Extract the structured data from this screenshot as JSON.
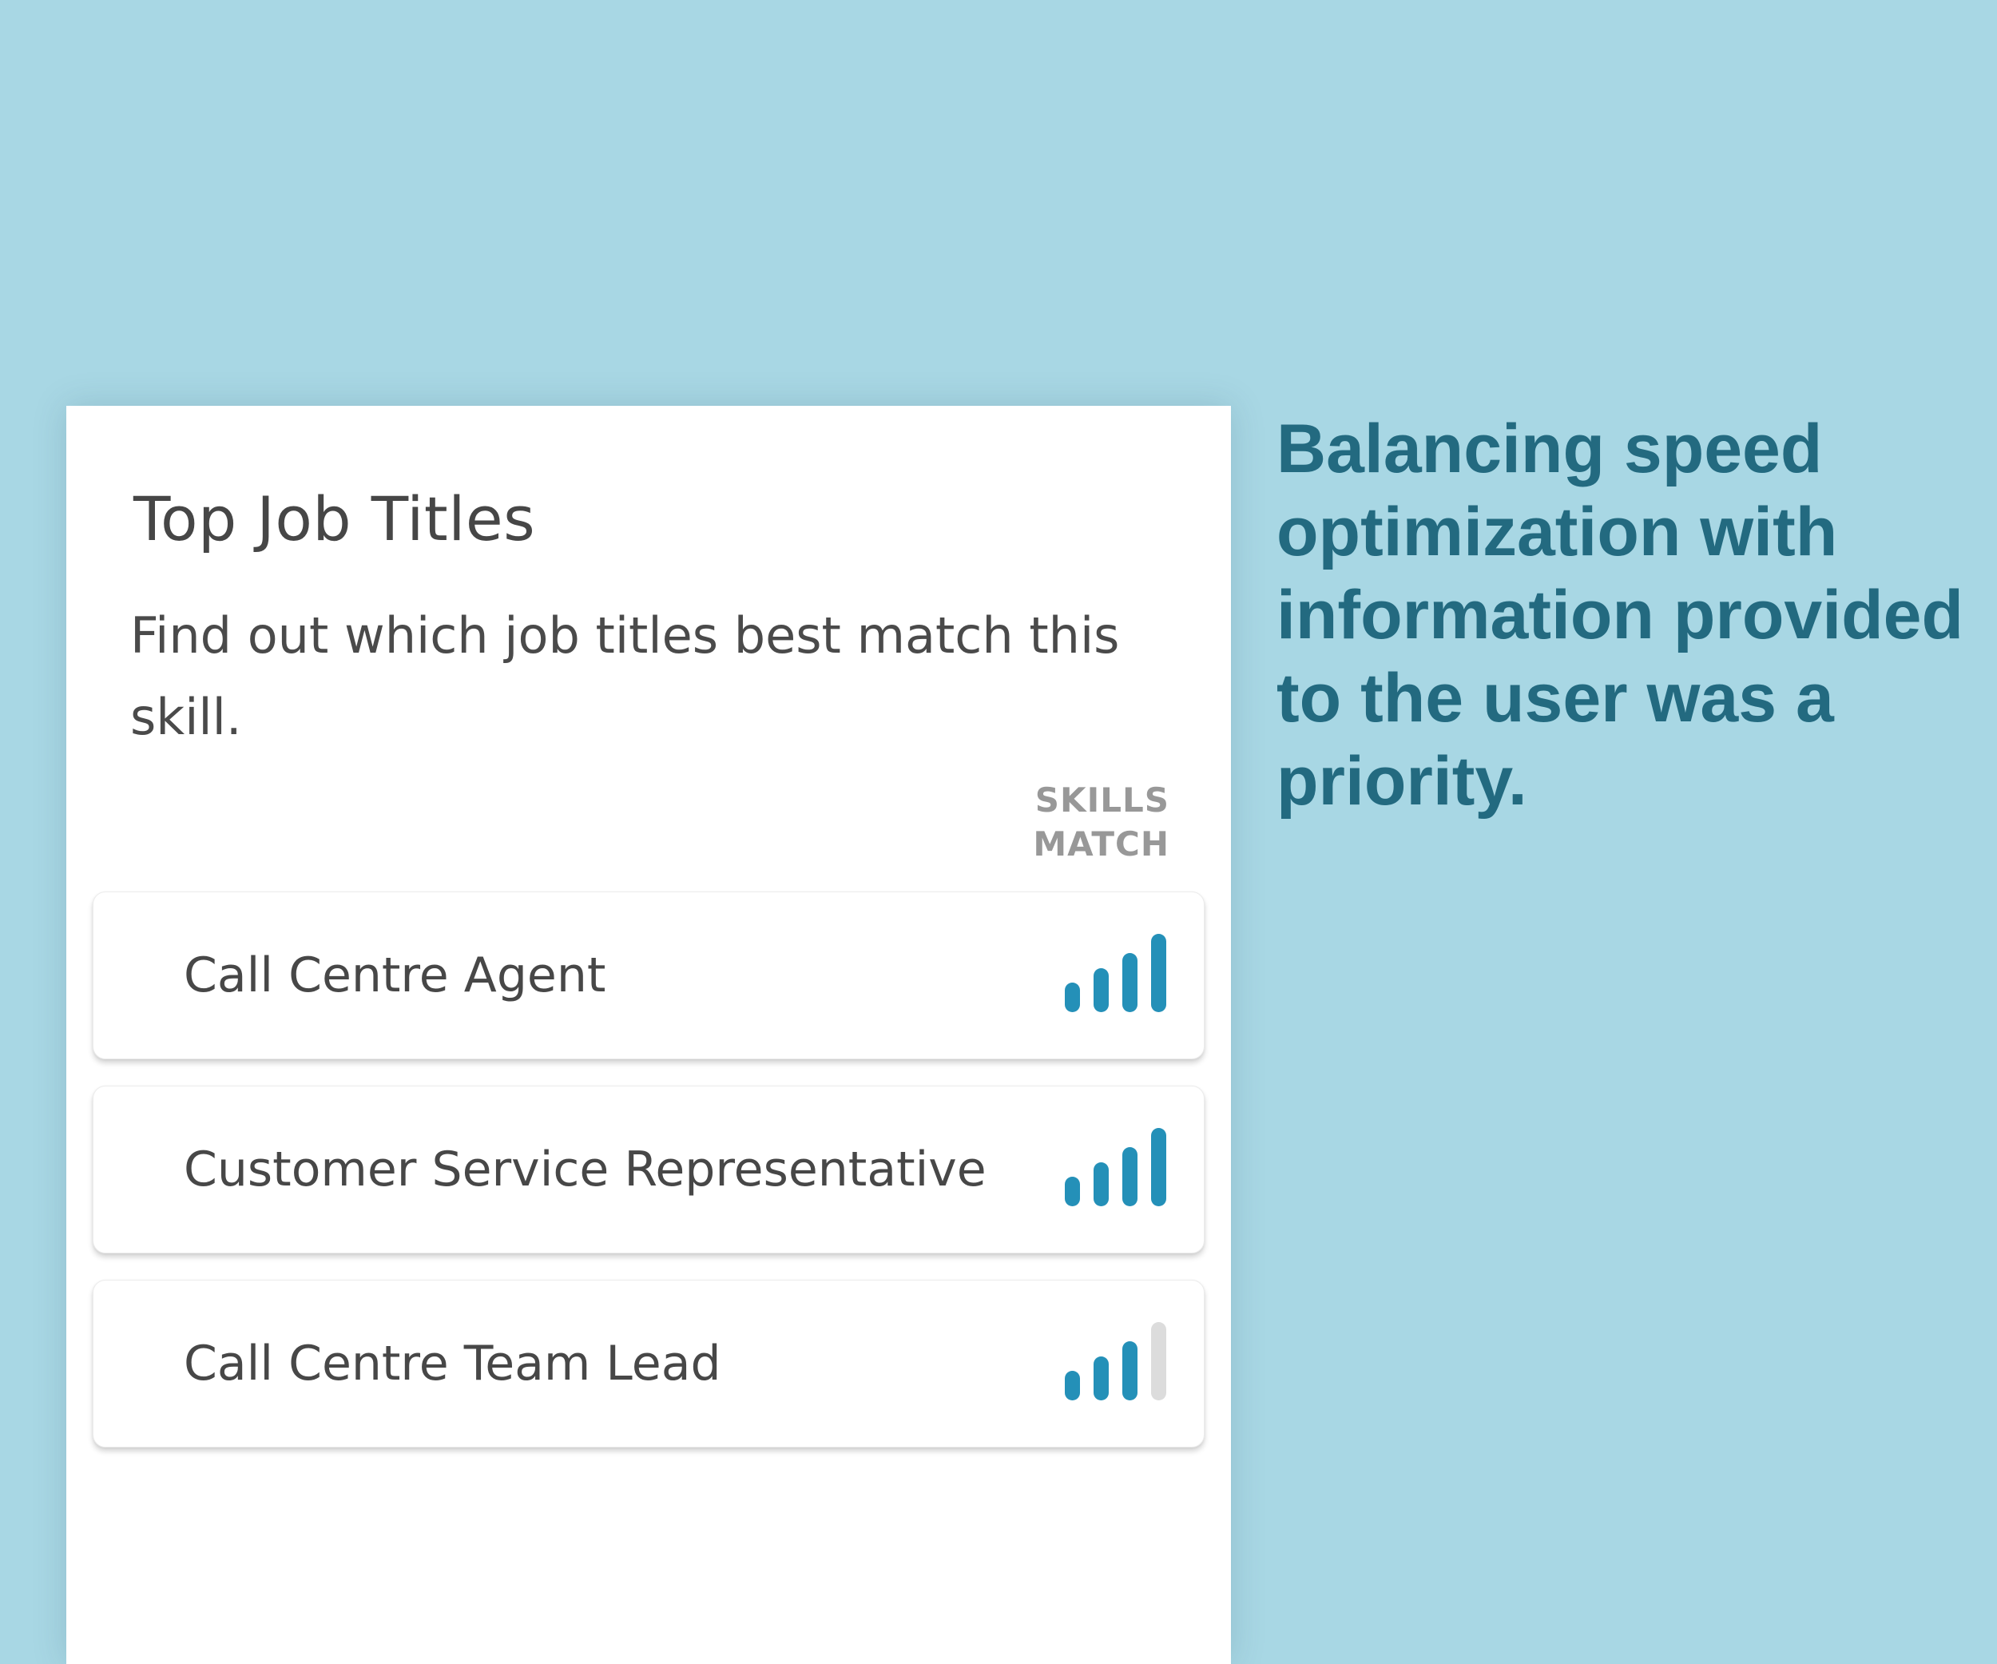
{
  "panel": {
    "title": "Top Job Titles",
    "description": "Find out which job titles best match this skill.",
    "column_header": [
      "SKILLS",
      "MATCH"
    ]
  },
  "jobs": [
    {
      "title": "Call Centre Agent",
      "skills_match_level": 4,
      "skills_match_max": 4
    },
    {
      "title": "Customer Service Representative",
      "skills_match_level": 4,
      "skills_match_max": 4
    },
    {
      "title": "Call Centre Team Lead",
      "skills_match_level": 3,
      "skills_match_max": 4
    }
  ],
  "side_note": "Balancing speed optimization with information provided to the user was a priority.",
  "icons": {
    "skills_match": "signal-bars-icon"
  },
  "colors": {
    "background": "#a8d7e4",
    "bar_active": "#2490b8",
    "bar_inactive": "#dcdcdc",
    "side_note_text": "#236a80"
  }
}
